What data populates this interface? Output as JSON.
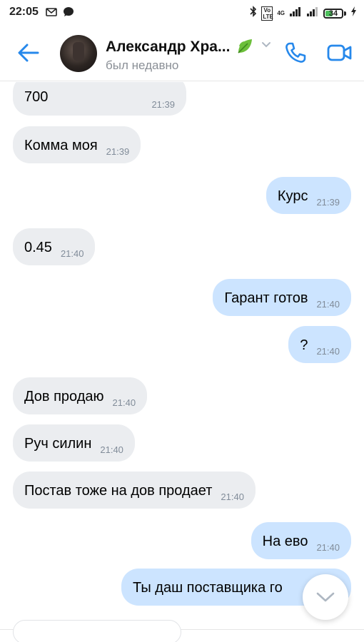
{
  "status_bar": {
    "time": "22:05",
    "network_label": "4G",
    "volte_label": "Vo LTE",
    "battery": "34"
  },
  "header": {
    "contact_name": "Александр Хра...",
    "contact_status": "был недавно"
  },
  "messages": [
    {
      "dir": "in",
      "text": "700",
      "time": "21:39"
    },
    {
      "dir": "in",
      "text": "Комма моя",
      "time": "21:39"
    },
    {
      "dir": "out",
      "text": "Курс",
      "time": "21:39"
    },
    {
      "dir": "in",
      "text": "0.45",
      "time": "21:40"
    },
    {
      "dir": "out",
      "text": "Гарант готов",
      "time": "21:40"
    },
    {
      "dir": "out",
      "text": "?",
      "time": "21:40"
    },
    {
      "dir": "in",
      "text": "Дов продаю",
      "time": "21:40"
    },
    {
      "dir": "in",
      "text": "Руч силин",
      "time": "21:40"
    },
    {
      "dir": "in",
      "text": "Постав тоже на дов продает",
      "time": "21:40"
    },
    {
      "dir": "out",
      "text": "На ево",
      "time": "21:40"
    },
    {
      "dir": "out",
      "text": "Ты даш поставщика го",
      "time": ""
    }
  ],
  "colors": {
    "accent": "#2688eb",
    "incoming_bubble": "#ebedf0",
    "outgoing_bubble": "#cce4ff",
    "time_text": "#818c99"
  }
}
